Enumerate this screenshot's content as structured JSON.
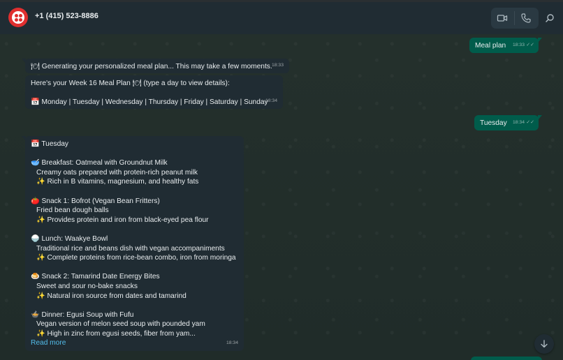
{
  "header": {
    "contact_name": "+1 (415) 523-8886",
    "icons": [
      "twilio-logo",
      "video-call-icon",
      "voice-call-icon",
      "search-icon"
    ]
  },
  "messages": [
    {
      "direction": "out",
      "text": "Meal plan",
      "time": "18:33",
      "status": "read"
    },
    {
      "direction": "in",
      "text": "🍽 Generating your personalized meal plan... This may take a few moments.",
      "time": "18:33"
    },
    {
      "direction": "in",
      "lines": [
        "Here's your Week 16 Meal Plan 🍽 (type a day to view details):",
        "",
        "📅 Monday | Tuesday | Wednesday | Thursday | Friday | Saturday | Sunday"
      ],
      "time": "18:34"
    },
    {
      "direction": "out",
      "text": "Tuesday",
      "time": "18:34",
      "status": "read"
    },
    {
      "direction": "in",
      "day": "📅 Tuesday",
      "sections": [
        {
          "title": "🥣 Breakfast: Oatmeal with Groundnut Milk",
          "desc": "Creamy oats prepared with protein-rich peanut milk",
          "note": "✨ Rich in B vitamins, magnesium, and healthy fats"
        },
        {
          "title": "🍅 Snack 1: Bofrot (Vegan Bean Fritters)",
          "desc": "Fried bean dough balls",
          "note": "✨ Provides protein and iron from black-eyed pea flour"
        },
        {
          "title": "🍚 Lunch: Waakye Bowl",
          "desc": "Traditional rice and beans dish with vegan accompaniments",
          "note": "✨ Complete proteins from rice-bean combo, iron from moringa"
        },
        {
          "title": "🍮 Snack 2: Tamarind Date Energy Bites",
          "desc": "Sweet and sour no-bake snacks",
          "note": "✨ Natural iron source from dates and tamarind"
        },
        {
          "title": "🍲 Dinner: Egusi Soup with Fufu",
          "desc": "Vegan version of melon seed soup with pounded yam",
          "note": "✨ High in zinc from egusi seeds, fiber from yam..."
        }
      ],
      "read_more": "Read more",
      "time": "18:34"
    }
  ],
  "colors": {
    "header_bg": "#202c33",
    "incoming_bubble": "#202c33",
    "outgoing_bubble": "#005c4b",
    "link": "#53bdeb",
    "avatar": "#e02f2f"
  }
}
